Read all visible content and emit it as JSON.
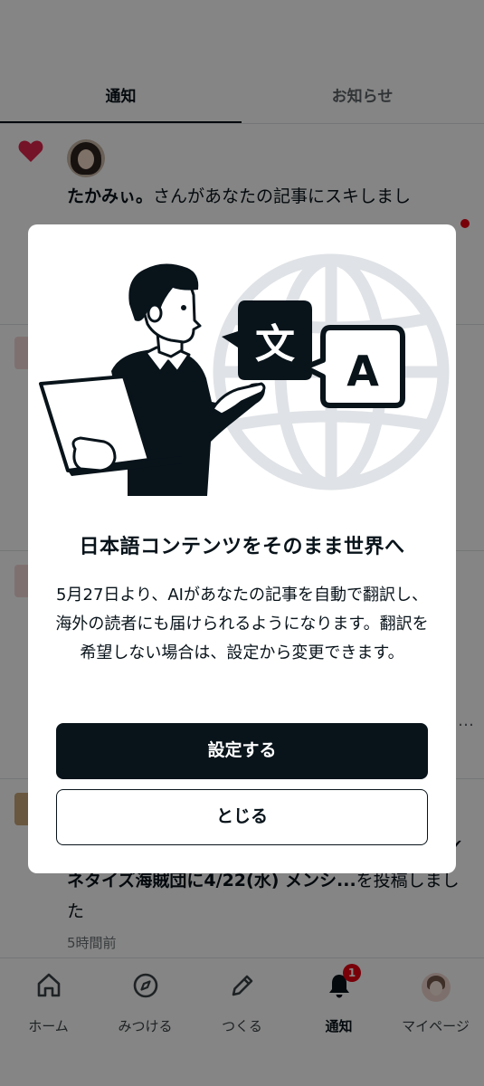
{
  "tabs": {
    "notifications_label": "通知",
    "news_label": "お知らせ"
  },
  "notifications": [
    {
      "user": "たかみぃ。",
      "text": "さんがあなたの記事にスキしまし",
      "icon": "heart-icon",
      "unread": true
    },
    {
      "highlight": "ネタイズ海賊団に4/22(水) メンシ...",
      "text": "を投稿しました",
      "time": "5時間前"
    }
  ],
  "modal": {
    "illustration_glyphs": {
      "japanese": "文",
      "english": "A"
    },
    "title": "日本語コンテンツをそのまま世界へ",
    "body": "5月27日より、AIがあなたの記事を自動で翻訳し、海外の読者にも届けられるようになります。翻訳を希望しない場合は、設定から変更できます。",
    "primary_button": "設定する",
    "secondary_button": "とじる"
  },
  "bottom_nav": [
    {
      "label": "ホーム",
      "icon": "home-icon"
    },
    {
      "label": "みつける",
      "icon": "compass-icon"
    },
    {
      "label": "つくる",
      "icon": "pencil-icon"
    },
    {
      "label": "通知",
      "icon": "bell-icon",
      "badge": "1",
      "active": true
    },
    {
      "label": "マイページ",
      "icon": "profile-avatar"
    }
  ],
  "colors": {
    "primary": "#08131a",
    "badge": "#e60012",
    "heart": "#e0254d",
    "globe": "#dfe2e6"
  }
}
